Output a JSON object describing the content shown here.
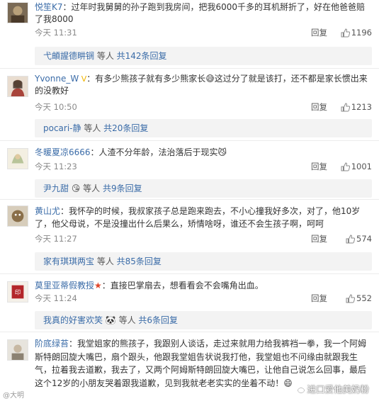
{
  "colors": {
    "link": "#3b6ca8",
    "muted": "#8a8a8a",
    "subbar": "#f3f3f3"
  },
  "comments": [
    {
      "user": "悦笙K7",
      "badge": "",
      "text": "：过年时我舅舅的孙子跑到我房间，把我6000千多的耳机掰折了，好在他爸爸赔了我8000",
      "time": "今天 11:31",
      "reply": "回复",
      "likes": "1196",
      "sub_users": "弋頔謃德畊锎",
      "sub_mid": " 等人 ",
      "sub_count": "共142条回复"
    },
    {
      "user": "Yvonne_W",
      "badge": "",
      "text": "：有多少熊孩子就有多少熊家长😅这过分了就是该打，还不都是家长惯出来的没教好",
      "time": "今天 10:50",
      "reply": "回复",
      "likes": "1213",
      "sub_users": "pocari-静",
      "sub_mid": " 等人 ",
      "sub_count": "共20条回复"
    },
    {
      "user": "冬暖夏凉6666",
      "badge": "",
      "text": "：人渣不分年龄，法治落后于现实😼",
      "time": "今天 11:23",
      "reply": "回复",
      "likes": "1001",
      "sub_users": "尹九甜",
      "sub_mid": " 等人 ",
      "sub_count": "共9条回复"
    },
    {
      "user": "黄山尤",
      "badge": "",
      "text": "：我怀孕的时候，我叔家孩子总是跑来跑去，不小心撞我好多次，对了，他10岁了，他父母说，不是没撞出什么后果么，矫情啥呀，谁还不会生孩子啊，呵呵",
      "time": "今天 11:27",
      "reply": "回复",
      "likes": "574",
      "sub_users": "家有琪琪两宝",
      "sub_mid": " 等人 ",
      "sub_count": "共85条回复"
    },
    {
      "user": "莫里亚蒂假教授",
      "badge": "★",
      "text": "：直接巴掌扇去，想看看会不会嘴角出血。",
      "time": "今天 11:24",
      "reply": "回复",
      "likes": "552",
      "sub_users": "我真的好害欢笑",
      "sub_mid": " 等人 ",
      "sub_count": "共6条回复"
    },
    {
      "user": "阶底绿苔",
      "badge": "",
      "text": "：我堂姐家的熊孩子，我跟别人谈话，走过来就用力给我裤裆一拳，我一个阿姆斯特朗回旋大嘴巴，扇个跟头，他跟我堂姐告状说我打他，我堂姐也不问缘由就跟我生气，拉着我去道歉，我去了，又两个阿姆斯特朗回旋大嘴巴，让他自己说怎么回事，最后这个12岁的小朋友哭着跟我道歉，见到我就老老实实的坐着不动！😄",
      "time": "",
      "reply": "",
      "likes": "",
      "sub_users": "",
      "sub_mid": "",
      "sub_count": ""
    }
  ],
  "watermark_left": "@大明",
  "watermark_right": "进口爱他美奶粉"
}
